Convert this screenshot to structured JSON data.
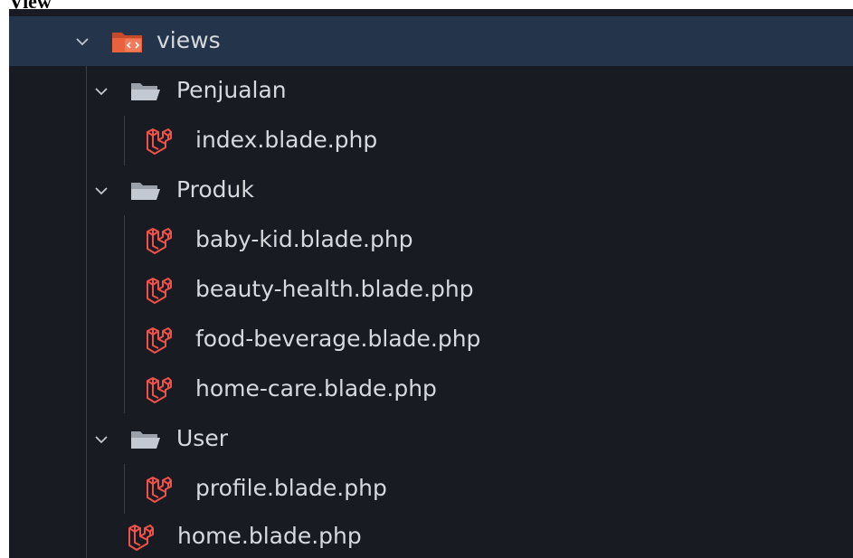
{
  "page_label": "View",
  "tree": {
    "root": {
      "label": "views",
      "icon": "views-folder-icon",
      "expanded": true
    },
    "folders": [
      {
        "label": "Penjualan",
        "expanded": true,
        "files": [
          "index.blade.php"
        ]
      },
      {
        "label": "Produk",
        "expanded": true,
        "files": [
          "baby-kid.blade.php",
          "beauty-health.blade.php",
          "food-beverage.blade.php",
          "home-care.blade.php"
        ]
      },
      {
        "label": "User",
        "expanded": true,
        "files": [
          "profile.blade.php"
        ]
      }
    ],
    "root_files": [
      "home.blade.php"
    ]
  },
  "colors": {
    "background": "#181b21",
    "selected_row": "#24344a",
    "text": "#d6d9de",
    "laravel_red": "#f0514a",
    "views_folder": "#e8623e"
  }
}
